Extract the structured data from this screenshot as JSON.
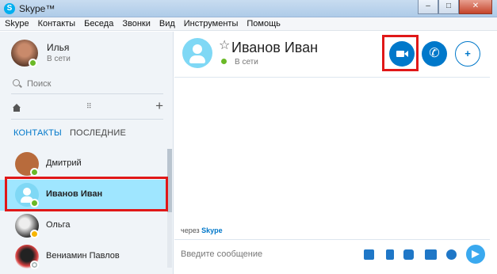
{
  "window": {
    "title": "Skype™",
    "app_icon_letter": "S",
    "minimize": "–",
    "maximize": "□",
    "close": "✕"
  },
  "menu": [
    "Skype",
    "Контакты",
    "Беседа",
    "Звонки",
    "Вид",
    "Инструменты",
    "Помощь"
  ],
  "me": {
    "name": "Илья",
    "status": "В сети"
  },
  "search": {
    "placeholder": "Поиск"
  },
  "toolbar": {
    "plus": "+"
  },
  "tabs": {
    "contacts": "КОНТАКТЫ",
    "recent": "ПОСЛЕДНИЕ"
  },
  "contacts": [
    {
      "name": "Дмитрий",
      "status": "online"
    },
    {
      "name": "Иванов Иван",
      "status": "online",
      "selected": true
    },
    {
      "name": "Ольга",
      "status": "away"
    },
    {
      "name": "Вениамин Павлов",
      "status": "offline"
    }
  ],
  "conversation": {
    "name": "Иванов Иван",
    "status": "В сети",
    "via_prefix": "через",
    "via_service": "Skype",
    "message_placeholder": "Введите сообщение",
    "add_people_symbol": "+",
    "call_symbol": "✆",
    "star_symbol": "☆"
  },
  "colors": {
    "accent": "#0078ca",
    "selected_row": "#9fe6ff",
    "online": "#6ab927",
    "highlight": "#e01818"
  }
}
